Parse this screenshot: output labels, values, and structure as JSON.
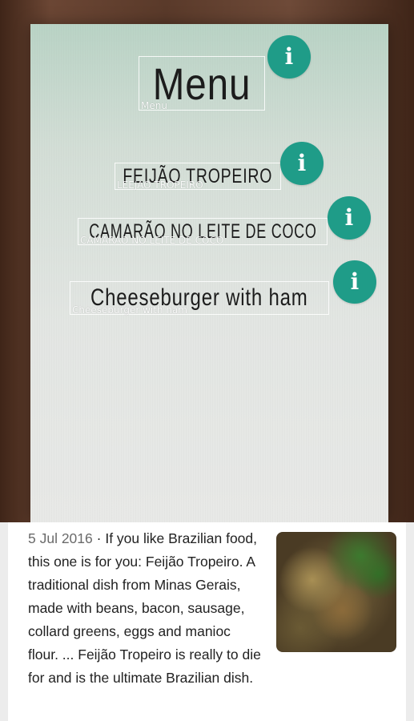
{
  "menu": {
    "title": "Menu",
    "title_ocr": "Menu",
    "items": [
      {
        "text": "FEIJÃO TROPEIRO",
        "ocr": "LEEJAO TROPEIRO"
      },
      {
        "text": "CAMARÃO NO LEITE DE COCO",
        "ocr": "CAMARAO NO LEITE DE COCO"
      },
      {
        "text": "Cheeseburger with ham",
        "ocr": "Cheeseburger with ham"
      }
    ],
    "info_glyph": "i"
  },
  "result": {
    "date": "5 Jul 2016",
    "separator": " · ",
    "snippet": "If you like Brazilian food, this one is for you: Feijão Tropeiro. A traditional dish from Minas Gerais, made with beans, bacon, sausage, collard greens, eggs and manioc flour. ... Feijão Tropeiro is really to die for and is the ultimate Brazilian dish.",
    "thumbnail_icon": "food-photo"
  },
  "colors": {
    "accent": "#1f9c88"
  }
}
